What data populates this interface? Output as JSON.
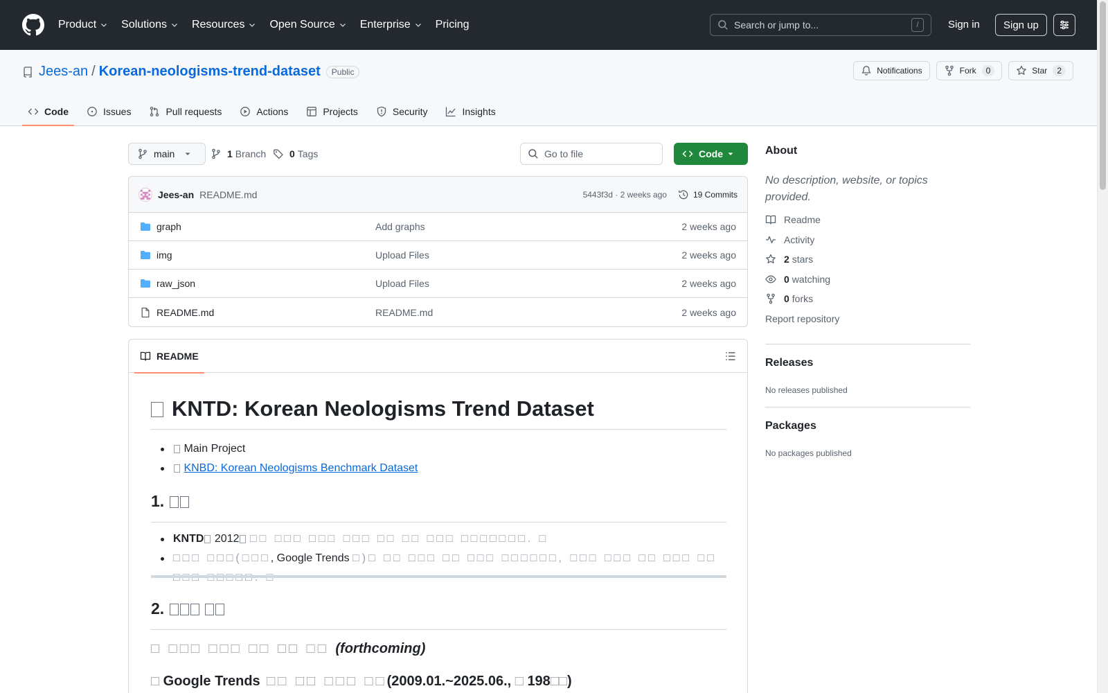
{
  "colors": {
    "header_bg": "#24292f",
    "link": "#0969da",
    "primary_button": "#1f883d",
    "active_tab_underline": "#fd8c73"
  },
  "header": {
    "nav": [
      "Product",
      "Solutions",
      "Resources",
      "Open Source",
      "Enterprise",
      "Pricing"
    ],
    "search_placeholder": "Search or jump to...",
    "search_shortcut": "/",
    "sign_in": "Sign in",
    "sign_up": "Sign up"
  },
  "repo": {
    "owner": "Jees-an",
    "separator": "/",
    "name": "Korean-neologisms-trend-dataset",
    "visibility": "Public",
    "notifications_label": "Notifications",
    "fork_label": "Fork",
    "fork_count": "0",
    "star_label": "Star",
    "star_count": "2",
    "tabs": [
      "Code",
      "Issues",
      "Pull requests",
      "Actions",
      "Projects",
      "Security",
      "Insights"
    ]
  },
  "toolbar": {
    "branch": "main",
    "branch_count": "1",
    "branch_label": "Branch",
    "tag_count": "0",
    "tag_label": "Tags",
    "goto_placeholder": "Go to file",
    "code_button": "Code"
  },
  "commit": {
    "author": "Jees-an",
    "message": "README.md",
    "meta": "5443f3d · 2 weeks ago",
    "commits": "19 Commits"
  },
  "files": [
    {
      "type": "folder",
      "name": "graph",
      "commit": "Add graphs",
      "date": "2 weeks ago"
    },
    {
      "type": "folder",
      "name": "img",
      "commit": "Upload Files",
      "date": "2 weeks ago"
    },
    {
      "type": "folder",
      "name": "raw_json",
      "commit": "Upload Files",
      "date": "2 weeks ago"
    },
    {
      "type": "file",
      "name": "README.md",
      "commit": "README.md",
      "date": "2 weeks ago"
    }
  ],
  "readme": {
    "tab_label": "README",
    "title": "KNTD: Korean Neologisms Trend Dataset",
    "links": {
      "main_project": "Main Project",
      "knbd": "KNBD: Korean Neologisms Benchmark Dataset"
    },
    "h2_1_num": "1.",
    "b1_bold": "KNTD",
    "b1_year": "2012",
    "b2_text": ", Google Trends",
    "h2_2_num": "2.",
    "forthcoming": "(forthcoming)",
    "gt_title": "Google Trends",
    "gt_range": "(2009.01.~2025.06.,",
    "gt_count": "198",
    "gt_close": ")"
  },
  "sidebar": {
    "about_title": "About",
    "about_desc": "No description, website, or topics provided.",
    "readme": "Readme",
    "activity": "Activity",
    "stars_count": "2",
    "stars_label": "stars",
    "watching_count": "0",
    "watching_label": "watching",
    "forks_count": "0",
    "forks_label": "forks",
    "report": "Report repository",
    "releases_title": "Releases",
    "releases_none": "No releases published",
    "packages_title": "Packages",
    "packages_none": "No packages published"
  }
}
